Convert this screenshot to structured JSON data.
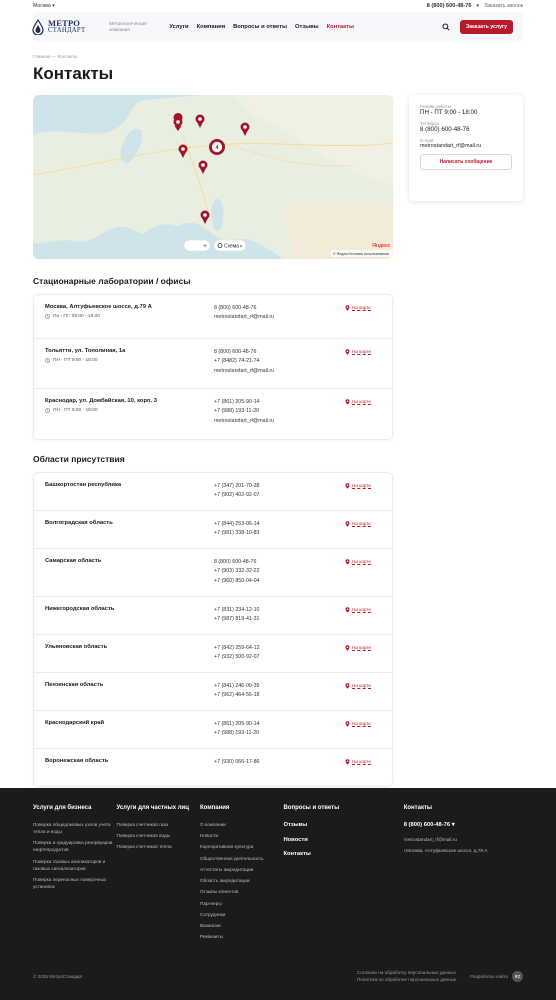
{
  "topbar": {
    "city": "Москва",
    "city_arrow": "▾",
    "phone": "8 (800) 600-48-76",
    "phone_arrow": "▾",
    "callback": "Заказать звонок"
  },
  "header": {
    "logo_line1": "МЕТРО",
    "logo_line2": "СТАНДАРТ",
    "tagline": "Метрологическая компания",
    "nav": [
      {
        "label": "Услуги"
      },
      {
        "label": "Компания"
      },
      {
        "label": "Вопросы и ответы"
      },
      {
        "label": "Отзывы"
      },
      {
        "label": "Контакты"
      }
    ],
    "order_button": "Заказать услугу"
  },
  "breadcrumbs": {
    "home": "Главная",
    "sep": "—",
    "current": "Контакты"
  },
  "page_title": "Контакты",
  "map": {
    "cluster_count": "4",
    "zoom_plus": "+",
    "scheme_label": "Схема",
    "yandex": "Яндекс",
    "footnote1": "© Яндекс",
    "footnote2": "Условия использования"
  },
  "info": {
    "hours_label": "Режим работы",
    "hours_value": "ПН - ПТ 9:00 - 18:00",
    "phone_label": "Телефон",
    "phone_value": "8 (800) 600-48-76",
    "email_label": "E-mail",
    "email_value": "metrostandart_rf@mail.ru",
    "write_button": "Написать сообщение"
  },
  "labs_title": "Стационарные лаборатории / офисы",
  "labs": [
    {
      "name": "Москва, Алтуфьевское шоссе, д.79 А",
      "hours": "Пн - Пт: 09:00 - 18:00",
      "lines": [
        "8 (800) 600-48-76",
        "metrostandart_rf@mail.ru"
      ],
      "map_link": "На карте"
    },
    {
      "name": "Тольятти, ул. Тополиная, 1а",
      "hours": "ПН - ПТ 9:00 - 18:00",
      "lines": [
        "8 (800) 600-48-76",
        "+7 (8482) 74-21-74",
        "metrostandart_rf@mail.ru"
      ],
      "map_link": "На карте"
    },
    {
      "name": "Краснодар, ул. Домбайская, 10, корп. 3",
      "hours": "ПН - ПТ 9:00 - 18:00",
      "lines": [
        "+7 (861) 205-90-14",
        "+7 (988) 193-11-20",
        "metrostandart_rf@mail.ru"
      ],
      "map_link": "На карте"
    }
  ],
  "regions_title": "Области присутствия",
  "regions": [
    {
      "name": "Башкортостан республика",
      "lines": [
        "+7 (347) 201-70-38",
        "+7 (902) 402-92-07"
      ],
      "map_link": "На карте"
    },
    {
      "name": "Волгоградская область",
      "lines": [
        "+7 (844) 253-06-14",
        "+7 (981) 338-10-83"
      ],
      "map_link": "На карте"
    },
    {
      "name": "Самарская область",
      "lines": [
        "8 (800) 600-48-76",
        "+7 (903) 332-32-22",
        "+7 (960) 850-04-04"
      ],
      "map_link": "На карте"
    },
    {
      "name": "Нижегородская область",
      "lines": [
        "+7 (831) 234-12-10",
        "+7 (987) 819-41-31"
      ],
      "map_link": "На карте"
    },
    {
      "name": "Ульяновская область",
      "lines": [
        "+7 (842) 259-64-12",
        "+7 (932) 500-92-07"
      ],
      "map_link": "На карте"
    },
    {
      "name": "Пензенская область",
      "lines": [
        "+7 (841) 246-00-39",
        "+7 (962) 464-56-18"
      ],
      "map_link": "На карте"
    },
    {
      "name": "Краснодарский край",
      "lines": [
        "+7 (861) 205-90-14",
        "+7 (988) 193-11-20"
      ],
      "map_link": "На карте"
    },
    {
      "name": "Воронежская область",
      "lines": [
        "+7 (930) 066-17-86"
      ],
      "map_link": "На карте"
    }
  ],
  "footer": {
    "col1_title": "Услуги для бизнеса",
    "col1_items": [
      "Поверка общедомовых узлов учета тепла и воды",
      "Поверка и градуировка резервуаров нефтепродуктов",
      "Поверка газовых анализаторов и газовых сигнализаторов",
      "Поверка переносных поверочных установок"
    ],
    "col2_title": "Услуги для частных лиц",
    "col2_items": [
      "Поверка счетчиков газа",
      "Поверка счетчиков воды",
      "Поверка счетчиков тепла"
    ],
    "col3_title": "Компания",
    "col3_items": [
      "О компании",
      "Новости",
      "Корпоративная культура",
      "Общественная деятельность",
      "Аттестаты аккредитации",
      "Область аккредитации",
      "Отзывы клиентов",
      "Партнеры",
      "Сотрудники",
      "Вакансии",
      "Реквизиты"
    ],
    "col4_title": "Вопросы и ответы",
    "col4_links": [
      "Отзывы",
      "Новости",
      "Контакты"
    ],
    "col5_title": "Контакты",
    "col5_phone": "8 (800) 600-48-76",
    "col5_email": "metrostandart_rf@mail.ru",
    "col5_address": "г.Москва, Алтуфьевское шоссе, д.79 А",
    "copyright": "© 2025 МетроСтандарт",
    "consent": "Согласие на обработку персональных данных",
    "policy": "Политика по обработке персональных данных",
    "dev": "Разработка сайта",
    "dev_badge": "RZ"
  }
}
